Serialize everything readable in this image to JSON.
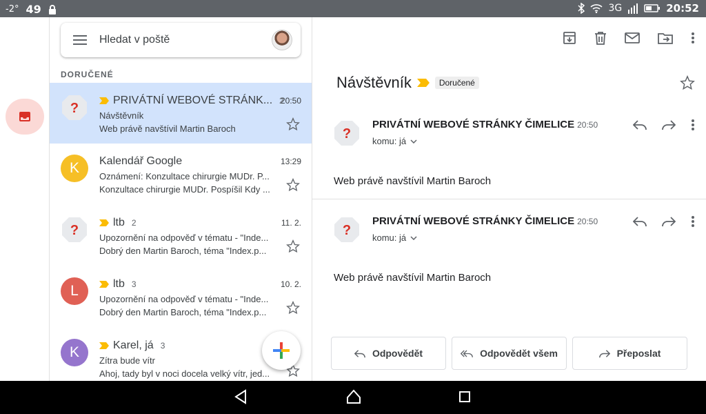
{
  "status": {
    "temp": "-2°",
    "badge": "49",
    "network": "3G",
    "clock": "20:52"
  },
  "search": {
    "placeholder": "Hledat v poště"
  },
  "list": {
    "section": "DORUČENÉ",
    "items": [
      {
        "avatar": "?",
        "avatar_color": "#eceff1",
        "sender": "PRIVÁTNÍ WEBOVÉ STRÁNK...",
        "count": "2",
        "time": "20:50",
        "subject": "Návštěvník",
        "snippet": "Web právě navštívil Martin Baroch",
        "important": true
      },
      {
        "avatar": "K",
        "avatar_color": "#f6bf26",
        "sender": "Kalendář Google",
        "count": "",
        "time": "13:29",
        "subject": "Oznámení: Konzultace chirurgie MUDr. P...",
        "snippet": "Konzultace chirurgie MUDr. Pospíšil Kdy ...",
        "important": false
      },
      {
        "avatar": "?",
        "avatar_color": "#eceff1",
        "sender": "ltb",
        "count": "2",
        "time": "11. 2.",
        "subject": "Upozornění na odpověď v tématu - \"Inde...",
        "snippet": "Dobrý den Martin Baroch, téma \"Index.p...",
        "important": true
      },
      {
        "avatar": "L",
        "avatar_color": "#e06055",
        "sender": "ltb",
        "count": "3",
        "time": "10. 2.",
        "subject": "Upozornění na odpověď v tématu - \"Inde...",
        "snippet": "Dobrý den Martin Baroch, téma \"Index.p...",
        "important": true
      },
      {
        "avatar": "K",
        "avatar_color": "#9575cd",
        "sender": "Karel, já",
        "count": "3",
        "time": "",
        "subject": "Zítra bude vítr",
        "snippet": "Ahoj, tady byl v noci docela velký vítr, jed...",
        "important": true
      }
    ]
  },
  "detail": {
    "title": "Návštěvník",
    "label": "Doručené",
    "messages": [
      {
        "from": "PRIVÁTNÍ WEBOVÉ STRÁNKY ČIMELICE",
        "time": "20:50",
        "to": "komu: já",
        "body": "Web právě navštívil Martin Baroch"
      },
      {
        "from": "PRIVÁTNÍ WEBOVÉ STRÁNKY ČIMELICE",
        "time": "20:50",
        "to": "komu: já",
        "body": "Web právě navštívil Martin Baroch"
      }
    ],
    "buttons": {
      "reply": "Odpovědět",
      "reply_all": "Odpovědět všem",
      "forward": "Přeposlat"
    }
  },
  "colors": {
    "accent_red": "#d93025",
    "selected_row": "#d2e3fc",
    "important": "#fbbc04"
  },
  "icons": [
    "menu-icon",
    "inbox-icon",
    "archive-icon",
    "trash-icon",
    "mail-icon",
    "move-icon",
    "more-vert-icon",
    "star-icon",
    "reply-icon",
    "forward-icon",
    "reply-all-icon",
    "compose-plus-icon",
    "important-marker-icon"
  ]
}
